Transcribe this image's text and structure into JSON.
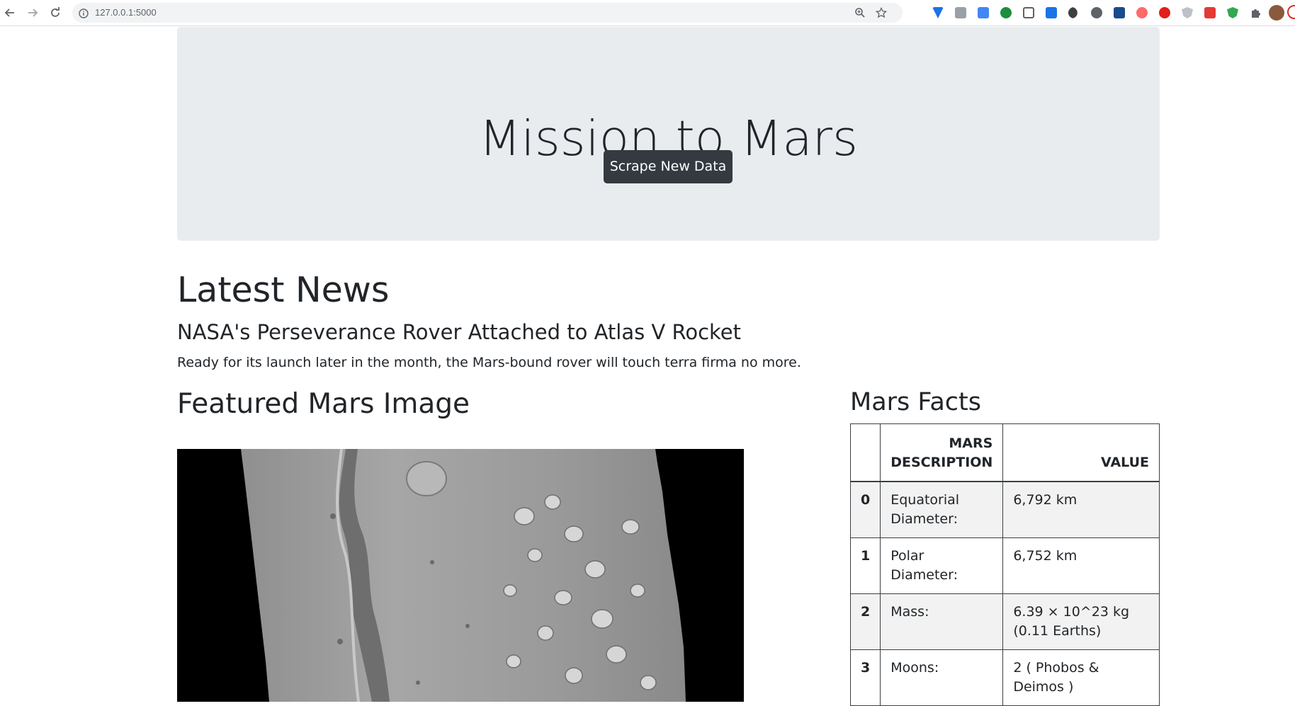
{
  "browser": {
    "url": "127.0.0.1:5000"
  },
  "jumbotron": {
    "title": "Mission to Mars",
    "button_label": "Scrape New Data"
  },
  "news": {
    "heading": "Latest News",
    "title": "NASA's Perseverance Rover Attached to Atlas V Rocket",
    "paragraph": "Ready for its launch later in the month, the Mars-bound rover will touch terra firma no more."
  },
  "featured": {
    "heading": "Featured Mars Image"
  },
  "facts": {
    "heading": "Mars Facts",
    "header_description": "MARS DESCRIPTION",
    "header_value": "VALUE",
    "rows": [
      {
        "index": "0",
        "description": "Equatorial Diameter:",
        "value": "6,792 km"
      },
      {
        "index": "1",
        "description": "Polar Diameter:",
        "value": "6,752 km"
      },
      {
        "index": "2",
        "description": "Mass:",
        "value": "6.39 × 10^23 kg (0.11 Earths)"
      },
      {
        "index": "3",
        "description": "Moons:",
        "value": "2 ( Phobos & Deimos )"
      }
    ]
  },
  "colors": {
    "jumbotron_bg": "#e9ecef",
    "button_bg": "#343a40",
    "text": "#212529"
  }
}
